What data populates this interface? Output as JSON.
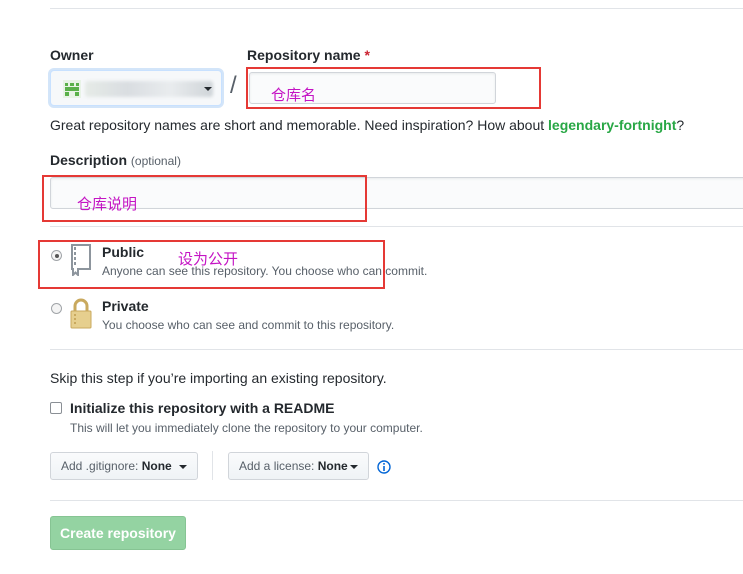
{
  "owner": {
    "label": "Owner"
  },
  "repo_name": {
    "label": "Repository name",
    "required_mark": "*",
    "value": "",
    "annotation": "仓库名"
  },
  "separator": "/",
  "hint": {
    "text": "Great repository names are short and memorable. Need inspiration? How about",
    "suggestion": "legendary-fortnight",
    "suffix": "?"
  },
  "description": {
    "label": "Description",
    "optional": "(optional)",
    "value": "",
    "annotation": "仓库说明"
  },
  "visibility": {
    "public": {
      "title": "Public",
      "note": "Anyone can see this repository. You choose who can commit.",
      "annotation": "设为公开",
      "selected": true
    },
    "private": {
      "title": "Private",
      "note": "You choose who can see and commit to this repository.",
      "selected": false
    }
  },
  "import_note": "Skip this step if you’re importing an existing repository.",
  "readme": {
    "label": "Initialize this repository with a README",
    "note": "This will let you immediately clone the repository to your computer."
  },
  "gitignore": {
    "prefix": "Add .gitignore:",
    "value": "None"
  },
  "license": {
    "prefix": "Add a license:",
    "value": "None"
  },
  "create_button": "Create repository",
  "colors": {
    "accent_green": "#2cbe4e",
    "annotation_red": "#e53935",
    "annotation_text": "#c414c4",
    "link_green": "#28a745"
  }
}
